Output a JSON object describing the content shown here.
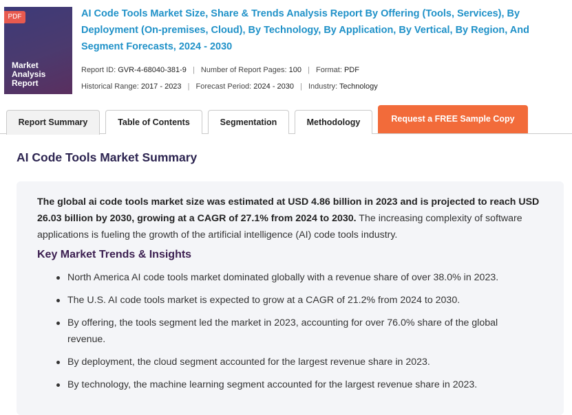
{
  "cover": {
    "badge": "PDF",
    "line1": "Market",
    "line2": "Analysis",
    "line3": "Report"
  },
  "report": {
    "title": "AI Code Tools Market Size, Share & Trends Analysis Report By Offering (Tools, Services), By Deployment (On-premises, Cloud), By Technology, By Application, By Vertical, By Region, And Segment Forecasts, 2024 - 2030",
    "report_id_label": "Report ID:",
    "report_id": "GVR-4-68040-381-9",
    "pages_label": "Number of Report Pages:",
    "pages": "100",
    "format_label": "Format:",
    "format": "PDF",
    "historical_label": "Historical Range:",
    "historical": "2017 - 2023",
    "forecast_label": "Forecast Period:",
    "forecast": "2024 - 2030",
    "industry_label": "Industry:",
    "industry": "Technology"
  },
  "tabs": [
    {
      "label": "Report Summary"
    },
    {
      "label": "Table of Contents"
    },
    {
      "label": "Segmentation"
    },
    {
      "label": "Methodology"
    }
  ],
  "cta_label": "Request a FREE Sample Copy",
  "summary": {
    "heading": "AI Code Tools Market Summary",
    "intro_bold": "The global ai code tools market size was estimated at USD 4.86 billion in 2023 and is projected to reach USD 26.03 billion by 2030, growing at a CAGR of 27.1% from 2024 to 2030.",
    "intro_rest": " The increasing complexity of software applications is fueling the growth of the artificial intelligence (AI) code tools industry.",
    "trends_heading": "Key Market Trends & Insights",
    "bullets": [
      "North America AI code tools market dominated globally with a revenue share of over 38.0% in 2023.",
      "The U.S. AI code tools market is expected to grow at a CAGR of 21.2% from 2024 to 2030.",
      "By offering, the tools segment led the market in 2023, accounting for over 76.0% share of the global revenue.",
      "By deployment, the cloud segment accounted for the largest revenue share in 2023.",
      "By technology, the machine learning segment accounted for the largest revenue share in 2023."
    ]
  },
  "colors": {
    "title_blue": "#1f91c8",
    "cta_orange": "#f26b3a",
    "heading_purple": "#2c2450",
    "pdf_red": "#e85a4f"
  }
}
